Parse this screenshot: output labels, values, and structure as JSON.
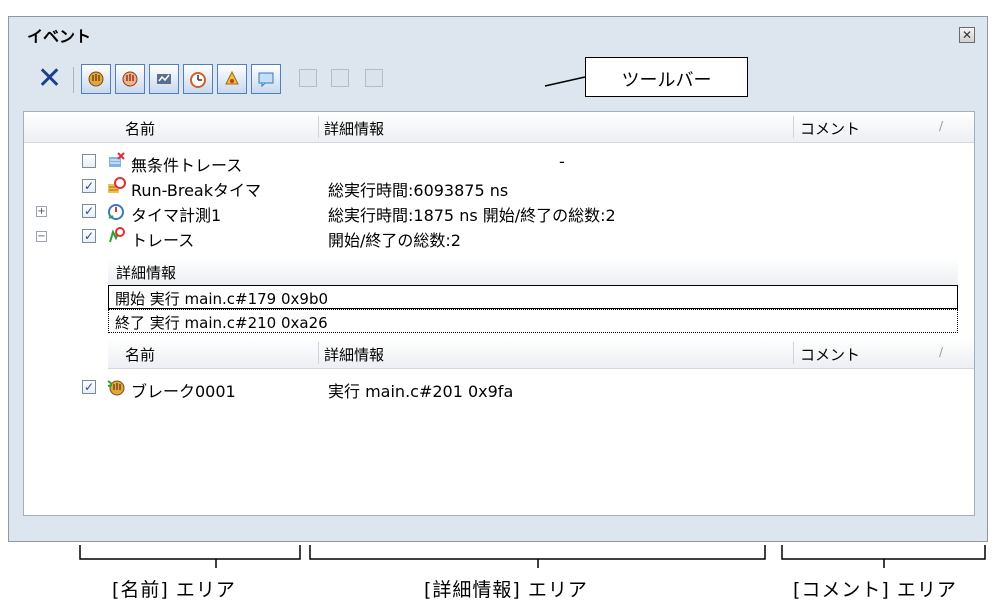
{
  "window": {
    "title": "イベント",
    "close_glyph": "✕"
  },
  "toolbar": {
    "delete_glyph": "✕",
    "buttons": [
      {
        "name": "hardware-break-icon",
        "color": "#d9a23a"
      },
      {
        "name": "software-break-icon",
        "color": "#d98a5a"
      },
      {
        "name": "trace-icon",
        "color": "#5b6e8c"
      },
      {
        "name": "timer-icon",
        "color": "#e08a3a"
      },
      {
        "name": "event-icon",
        "color": "#e0b63a"
      },
      {
        "name": "comment-icon",
        "color": "#6fa8d8"
      }
    ],
    "disabled_buttons": [
      "edit-icon",
      "copy-icon",
      "paste-icon"
    ]
  },
  "callout": {
    "label": "ツールバー"
  },
  "table": {
    "columns": {
      "name": "名前",
      "detail": "詳細情報",
      "comment": "コメント"
    },
    "rows": [
      {
        "expander": "",
        "checked": false,
        "icon": "unconditional-trace-icon",
        "name": "無条件トレース",
        "detail": "-"
      },
      {
        "expander": "",
        "checked": true,
        "icon": "run-break-timer-icon",
        "name": "Run-Breakタイマ",
        "detail": "総実行時間:6093875 ns"
      },
      {
        "expander": "+",
        "checked": true,
        "icon": "timer-measure-icon",
        "name": "タイマ計測1",
        "detail": "総実行時間:1875 ns  開始/終了の総数:2"
      },
      {
        "expander": "−",
        "checked": true,
        "icon": "trace-event-icon",
        "name": "トレース",
        "detail": "開始/終了の総数:2"
      }
    ],
    "sub": {
      "header": "詳細情報",
      "rows": [
        "開始  実行  main.c#179 0x9b0",
        "終了  実行  main.c#210 0xa26"
      ]
    },
    "columns2": {
      "name": "名前",
      "detail": "詳細情報",
      "comment": "コメント"
    },
    "rows2": [
      {
        "checked": true,
        "icon": "break-icon",
        "name": "ブレーク0001",
        "detail": "実行  main.c#201 0x9fa"
      }
    ]
  },
  "areas": {
    "name": "[名前] エリア",
    "detail": "[詳細情報] エリア",
    "comment": "[コメント] エリア"
  }
}
